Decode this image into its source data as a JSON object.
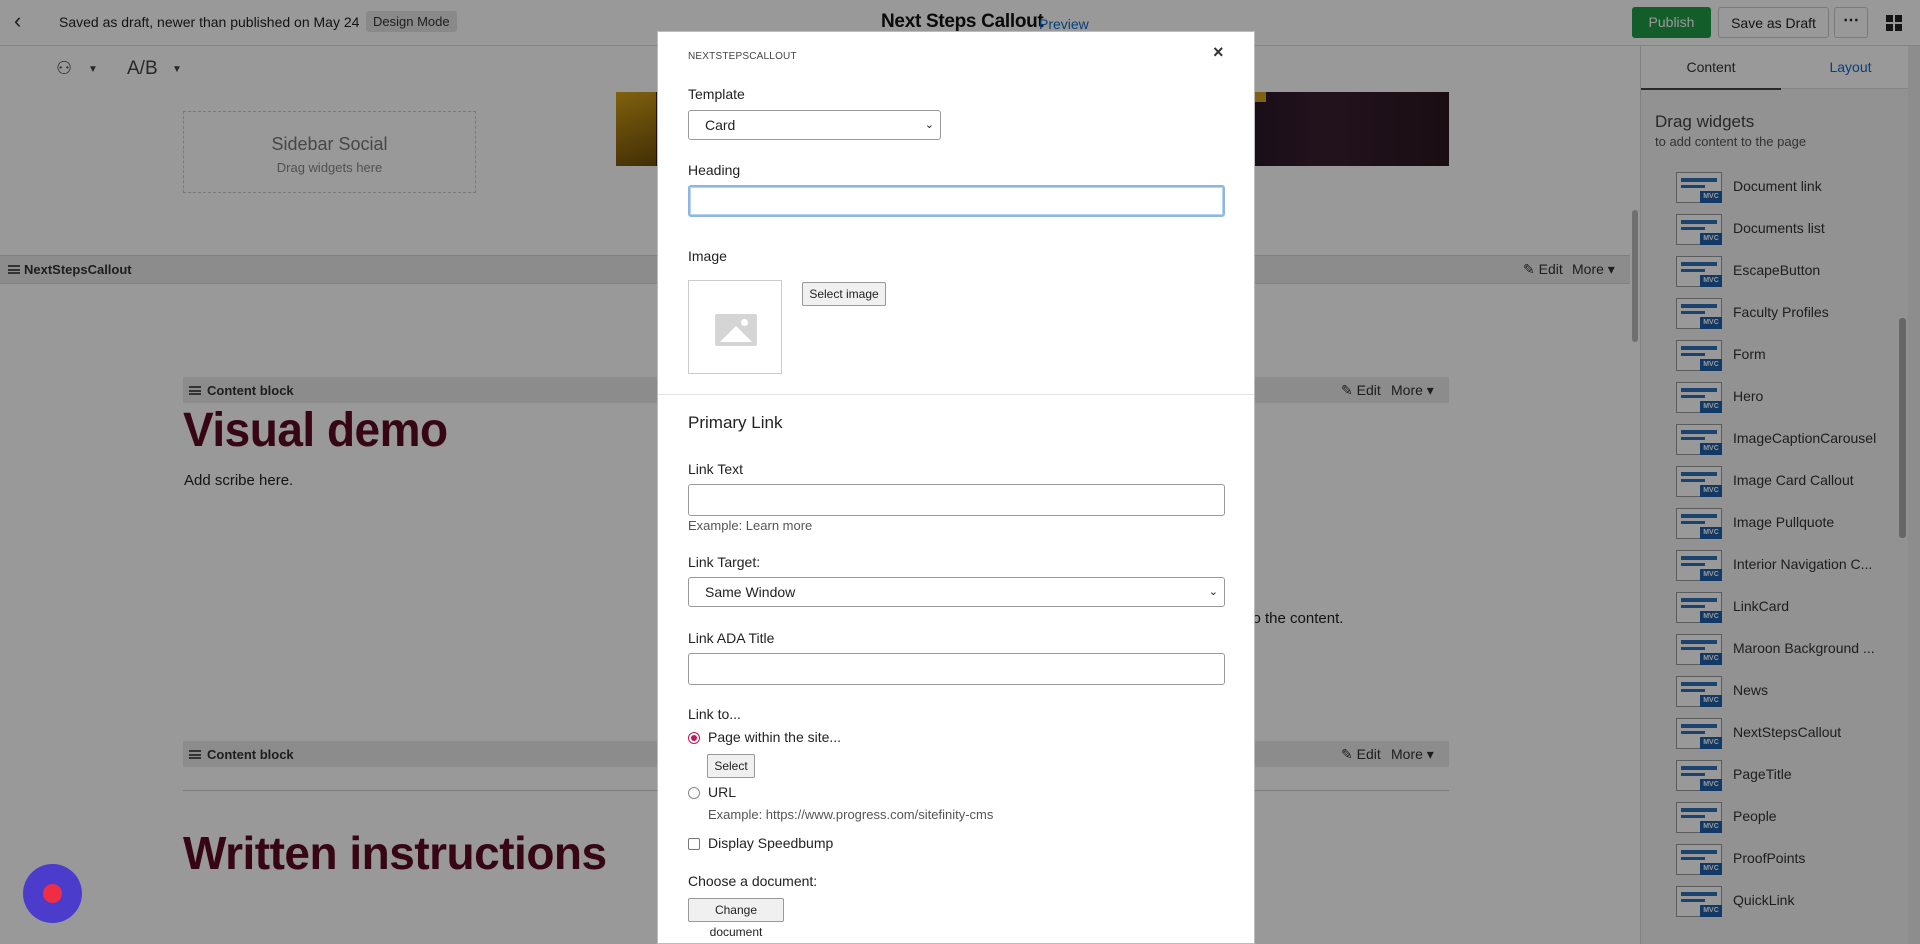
{
  "topbar": {
    "status_text": "Saved as draft, newer than published on May 24",
    "mode_badge": "Design Mode",
    "page_title": "Next Steps Callout",
    "preview_label": "Preview",
    "publish_label": "Publish",
    "save_draft_label": "Save as Draft",
    "more_label": "⋯"
  },
  "toolbar": {
    "ab_label": "A/B"
  },
  "canvas": {
    "sidebar_social_title": "Sidebar Social",
    "sidebar_social_hint": "Drag widgets here",
    "widget_name": "NextStepsCallout",
    "edit_label": "Edit",
    "more_label": "More",
    "content_block_label": "Content block",
    "visual_demo_heading": "Visual demo",
    "scribe_text": "Add scribe here.",
    "partial_text": "t to the content.",
    "written_heading": "Written instructions"
  },
  "right_panel": {
    "tab_content": "Content",
    "tab_layout": "Layout",
    "heading": "Drag widgets",
    "subheading": "to add content to the page",
    "mvc_badge": "MVC",
    "widgets": [
      "Document link",
      "Documents list",
      "EscapeButton",
      "Faculty Profiles",
      "Form",
      "Hero",
      "ImageCaptionCarousel",
      "Image Card Callout",
      "Image Pullquote",
      "Interior Navigation C...",
      "LinkCard",
      "Maroon Background ...",
      "News",
      "NextStepsCallout",
      "PageTitle",
      "People",
      "ProofPoints",
      "QuickLink"
    ]
  },
  "modal": {
    "title": "NEXTSTEPSCALLOUT",
    "close_label": "×",
    "template_label": "Template",
    "template_value": "Card",
    "heading_label": "Heading",
    "heading_value": "",
    "image_label": "Image",
    "select_image_label": "Select image",
    "primary_link_section": "Primary Link",
    "link_text_label": "Link Text",
    "link_text_value": "",
    "link_text_hint": "Example: Learn more",
    "link_target_label": "Link Target:",
    "link_target_value": "Same Window",
    "link_ada_label": "Link ADA Title",
    "link_ada_value": "",
    "link_to_label": "Link to...",
    "option_page": "Page within the site...",
    "select_label": "Select",
    "option_url": "URL",
    "url_hint": "Example: https://www.progress.com/sitefinity-cms",
    "speedbump_label": "Display Speedbump",
    "choose_doc_label": "Choose a document:",
    "change_doc_label": "Change document"
  }
}
